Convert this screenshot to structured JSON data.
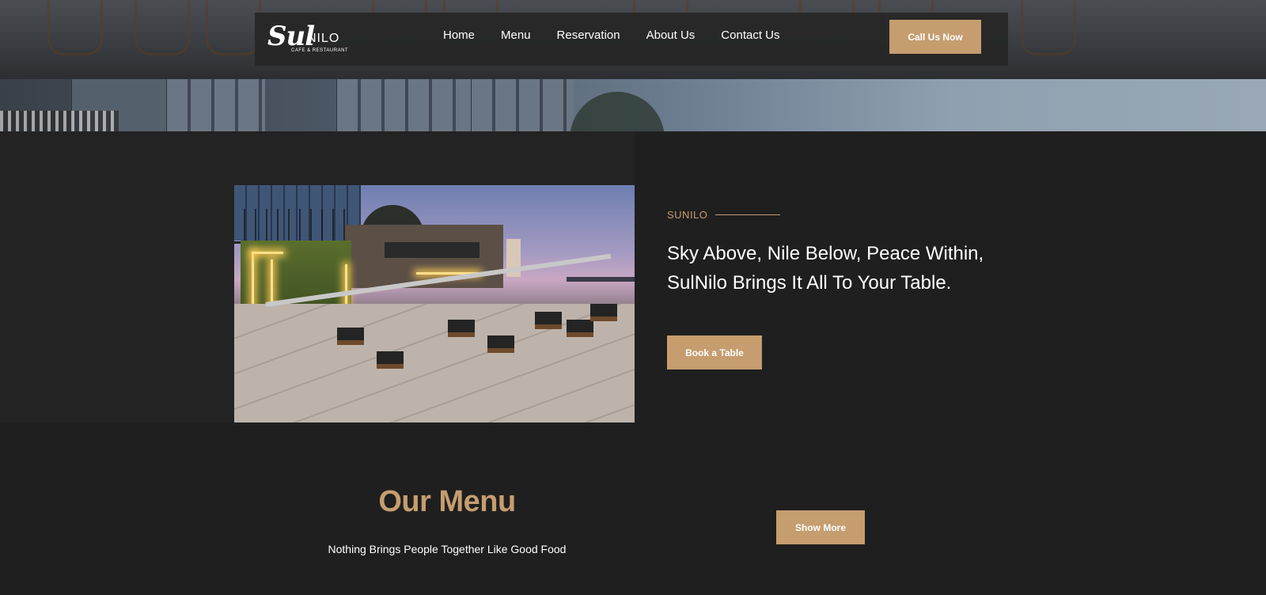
{
  "brand": {
    "script": "Sul",
    "name": "NILO",
    "tagline": "CAFE & RESTAURANT"
  },
  "nav": {
    "links": [
      "Home",
      "Menu",
      "Reservation",
      "About Us",
      "Contact Us"
    ],
    "cta_label": "Call Us Now"
  },
  "about": {
    "eyebrow": "SUNILO",
    "headline_line1": "Sky Above, Nile Below, Peace Within,",
    "headline_line2": "SulNilo Brings It All To Your Table.",
    "button_label": "Book a Table"
  },
  "menu": {
    "title": "Our Menu",
    "subtitle": "Nothing Brings People Together Like Good Food",
    "button_label": "Show More"
  },
  "colors": {
    "accent": "#c59d6f",
    "background": "#1f1f1f",
    "panel": "#232323",
    "text": "#ffffff"
  },
  "icons": {
    "logo": "sulnilo-logo"
  }
}
